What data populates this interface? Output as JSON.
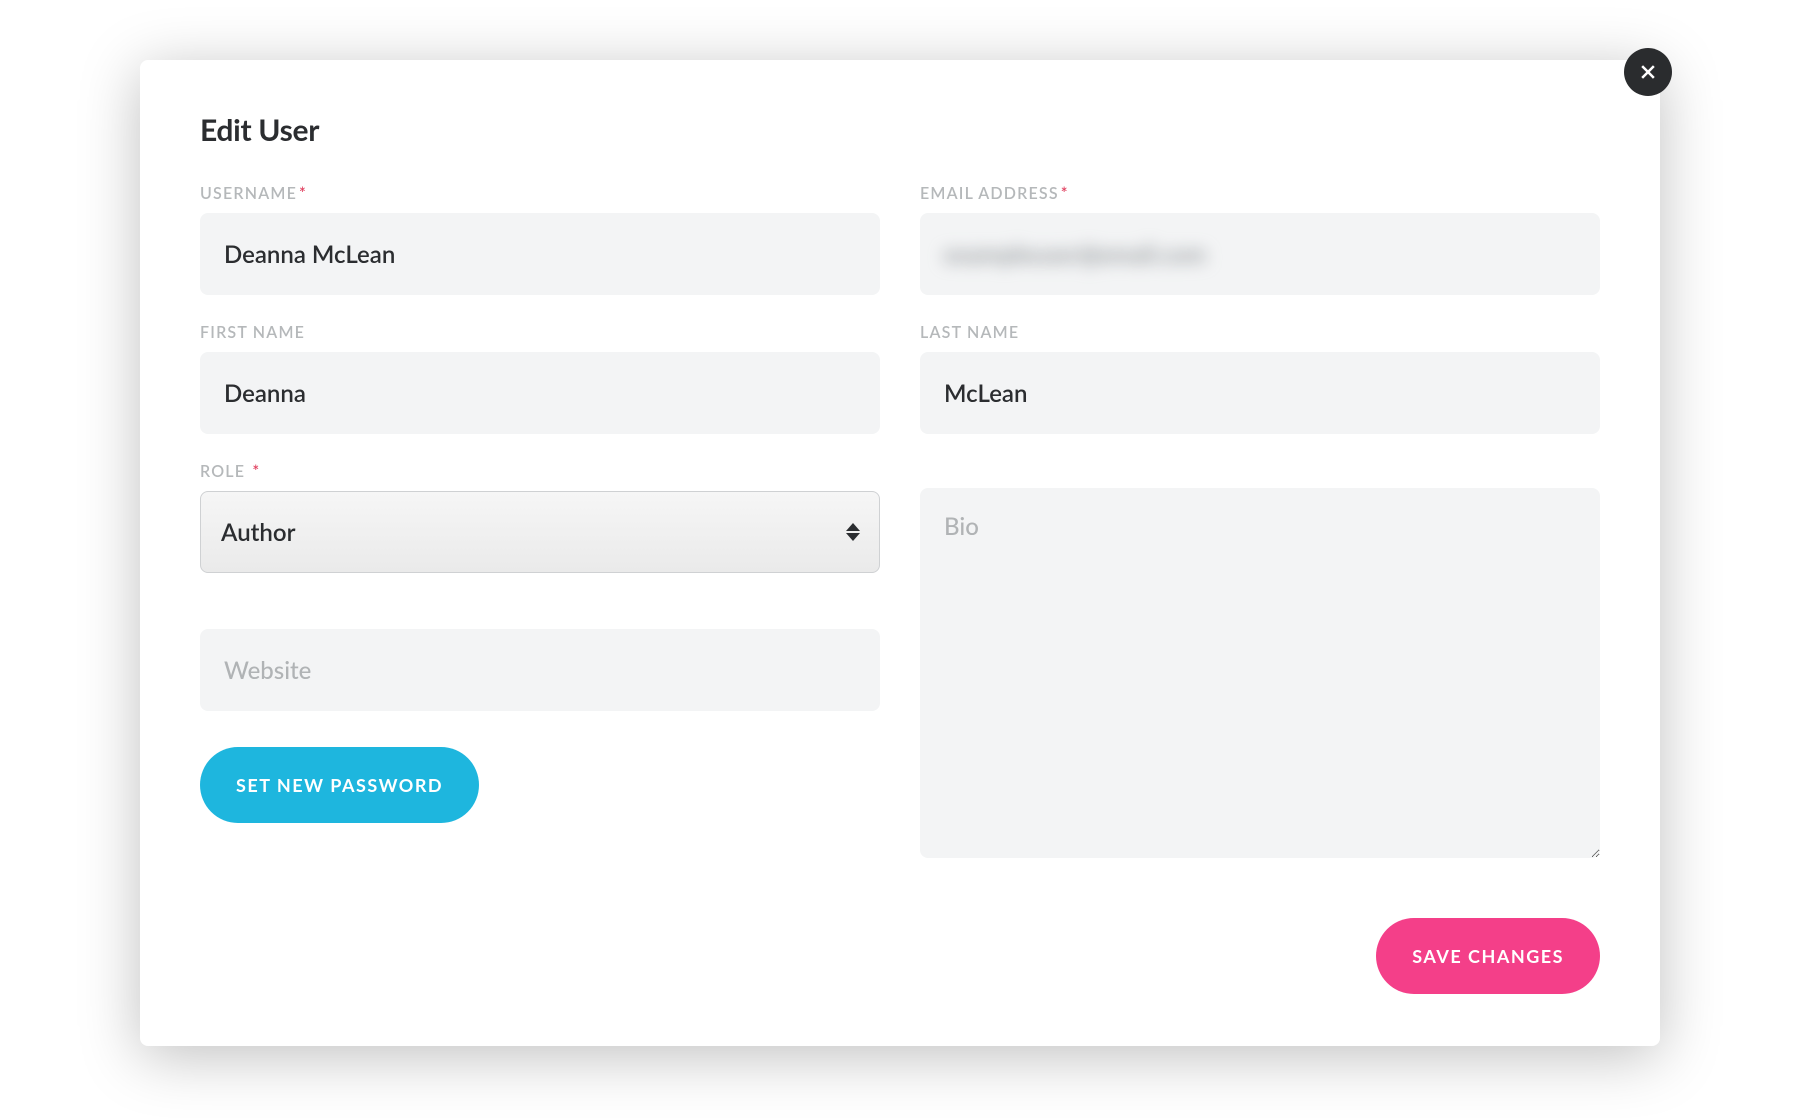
{
  "modal": {
    "title": "Edit User"
  },
  "fields": {
    "username": {
      "label": "USERNAME",
      "required": true,
      "value": "Deanna McLean"
    },
    "email": {
      "label": "EMAIL ADDRESS",
      "required": true,
      "value": "obscured"
    },
    "firstName": {
      "label": "FIRST NAME",
      "value": "Deanna"
    },
    "lastName": {
      "label": "LAST NAME",
      "value": "McLean"
    },
    "role": {
      "label": "ROLE",
      "required": true,
      "value": "Author"
    },
    "website": {
      "placeholder": "Website",
      "value": ""
    },
    "bio": {
      "placeholder": "Bio",
      "value": ""
    }
  },
  "buttons": {
    "setPassword": "SET NEW PASSWORD",
    "save": "SAVE CHANGES"
  },
  "required_marker": "*"
}
